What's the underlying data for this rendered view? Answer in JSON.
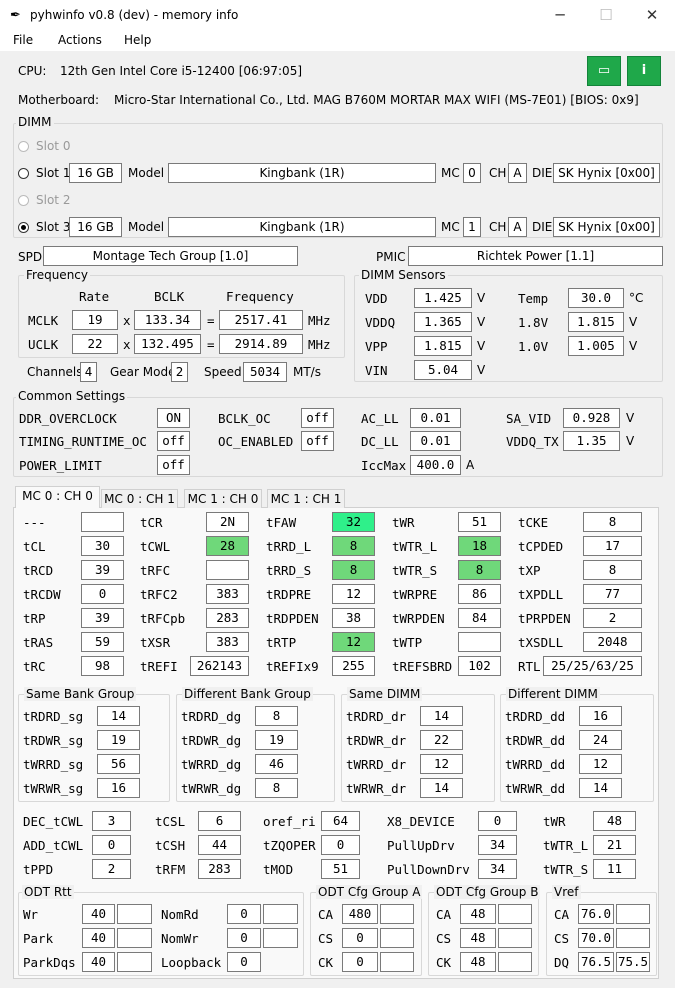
{
  "window": {
    "title": "pyhwinfo v0.8 (dev) - memory info",
    "icon": "feather-icon",
    "minimize": "─",
    "maximize": "☐",
    "close": "✕"
  },
  "menu": {
    "file": "File",
    "actions": "Actions",
    "help": "Help"
  },
  "cpu": {
    "label": "CPU:",
    "value": "12th Gen Intel Core i5-12400  [06:97:05]"
  },
  "mb": {
    "label": "Motherboard:",
    "value": "Micro-Star International Co., Ltd. MAG B760M MORTAR MAX WIFI (MS-7E01)  [BIOS: 0x9]"
  },
  "buttons": {
    "save_icon": "▭",
    "info_icon": "i",
    "accent": "#1fa84a"
  },
  "dimm": {
    "title": "DIMM",
    "model_label": "Model",
    "mc_label": "MC",
    "ch_label": "CH",
    "die_label": "DIE",
    "slots": [
      {
        "label": "Slot 0",
        "enabled": false,
        "checked": false
      },
      {
        "label": "Slot 1",
        "enabled": true,
        "checked": false,
        "size": "16 GB",
        "model": "Kingbank      (1R)",
        "mc": "0",
        "ch": "A",
        "die": "SK Hynix [0x00]"
      },
      {
        "label": "Slot 2",
        "enabled": false,
        "checked": false
      },
      {
        "label": "Slot 3",
        "enabled": true,
        "checked": true,
        "size": "16 GB",
        "model": "Kingbank      (1R)",
        "mc": "1",
        "ch": "A",
        "die": "SK Hynix [0x00]"
      }
    ]
  },
  "spd": {
    "label": "SPD",
    "value": "Montage Tech Group [1.0]"
  },
  "pmic": {
    "label": "PMIC",
    "value": "Richtek Power [1.1]"
  },
  "freq": {
    "title": "Frequency",
    "h_rate": "Rate",
    "h_bclk": "BCLK",
    "h_freq": "Frequency",
    "x": "x",
    "eq": "=",
    "mhz": "MHz",
    "mclk": {
      "label": "MCLK",
      "rate": "19",
      "bclk": "133.34",
      "freq": "2517.41"
    },
    "uclk": {
      "label": "UCLK",
      "rate": "22",
      "bclk": "132.495",
      "freq": "2914.89"
    },
    "channels_label": "Channels",
    "channels": "4",
    "gear_label": "Gear Mode",
    "gear": "2",
    "speed_label": "Speed",
    "speed": "5034",
    "speed_unit": "MT/s"
  },
  "sensors": {
    "title": "DIMM Sensors",
    "v": "V",
    "c": "°C",
    "vdd": {
      "label": "VDD",
      "value": "1.425"
    },
    "vddq": {
      "label": "VDDQ",
      "value": "1.365"
    },
    "vpp": {
      "label": "VPP",
      "value": "1.815"
    },
    "vin": {
      "label": "VIN",
      "value": "5.04"
    },
    "temp": {
      "label": "Temp",
      "value": "30.0"
    },
    "v18": {
      "label": "1.8V",
      "value": "1.815"
    },
    "v10": {
      "label": "1.0V",
      "value": "1.005"
    }
  },
  "common": {
    "title": "Common Settings",
    "v": "V",
    "a": "A",
    "ddr_oc": {
      "label": "DDR_OVERCLOCK",
      "value": "ON"
    },
    "bclk_oc": {
      "label": "BCLK_OC",
      "value": "off"
    },
    "ac_ll": {
      "label": "AC_LL",
      "value": "0.01"
    },
    "sa_vid": {
      "label": "SA_VID",
      "value": "0.928"
    },
    "timing_rt": {
      "label": "TIMING_RUNTIME_OC",
      "value": "off"
    },
    "oc_en": {
      "label": "OC_ENABLED",
      "value": "off"
    },
    "dc_ll": {
      "label": "DC_LL",
      "value": "0.01"
    },
    "vddq_tx": {
      "label": "VDDQ_TX",
      "value": "1.35"
    },
    "power_limit": {
      "label": "POWER_LIMIT",
      "value": "off"
    },
    "iccmax": {
      "label": "IccMax",
      "value": "400.0"
    }
  },
  "tabs": [
    "MC 0 : CH 0",
    "MC 0 : CH 1",
    "MC 1 : CH 0",
    "MC 1 : CH 1"
  ],
  "timings": {
    "highlight_color": "#6fd87a",
    "rows": [
      [
        {
          "l": "---",
          "v": ""
        },
        {
          "l": "tCR",
          "v": "2N"
        },
        {
          "l": "tFAW",
          "v": "32",
          "h": "bg"
        },
        {
          "l": "tWR",
          "v": "51"
        },
        {
          "l": "tCKE",
          "v": "8"
        }
      ],
      [
        {
          "l": "tCL",
          "v": "30"
        },
        {
          "l": "tCWL",
          "v": "28",
          "h": "g"
        },
        {
          "l": "tRRD_L",
          "v": "8",
          "h": "g"
        },
        {
          "l": "tWTR_L",
          "v": "18",
          "h": "g"
        },
        {
          "l": "tCPDED",
          "v": "17"
        }
      ],
      [
        {
          "l": "tRCD",
          "v": "39"
        },
        {
          "l": "tRFC",
          "v": ""
        },
        {
          "l": "tRRD_S",
          "v": "8",
          "h": "g"
        },
        {
          "l": "tWTR_S",
          "v": "8",
          "h": "g"
        },
        {
          "l": "tXP",
          "v": "8"
        }
      ],
      [
        {
          "l": "tRCDW",
          "v": "0"
        },
        {
          "l": "tRFC2",
          "v": "383"
        },
        {
          "l": "tRDPRE",
          "v": "12"
        },
        {
          "l": "tWRPRE",
          "v": "86"
        },
        {
          "l": "tXPDLL",
          "v": "77"
        }
      ],
      [
        {
          "l": "tRP",
          "v": "39"
        },
        {
          "l": "tRFCpb",
          "v": "283"
        },
        {
          "l": "tRDPDEN",
          "v": "38"
        },
        {
          "l": "tWRPDEN",
          "v": "84"
        },
        {
          "l": "tPRPDEN",
          "v": "2"
        }
      ],
      [
        {
          "l": "tRAS",
          "v": "59"
        },
        {
          "l": "tXSR",
          "v": "383"
        },
        {
          "l": "tRTP",
          "v": "12",
          "h": "g"
        },
        {
          "l": "tWTP",
          "v": ""
        },
        {
          "l": "tXSDLL",
          "v": "2048"
        }
      ],
      [
        {
          "l": "tRC",
          "v": "98"
        },
        {
          "l": "tREFI",
          "v": "262143"
        },
        {
          "l": "tREFIx9",
          "v": "255"
        },
        {
          "l": "tREFSBRD",
          "v": "102"
        },
        {
          "l": "RTL",
          "v": "25/25/63/25"
        }
      ]
    ]
  },
  "groups": [
    {
      "title": "Same Bank Group",
      "rows": [
        {
          "l": "tRDRD_sg",
          "v": "14"
        },
        {
          "l": "tRDWR_sg",
          "v": "19"
        },
        {
          "l": "tWRRD_sg",
          "v": "56"
        },
        {
          "l": "tWRWR_sg",
          "v": "16"
        }
      ]
    },
    {
      "title": "Different Bank Group",
      "rows": [
        {
          "l": "tRDRD_dg",
          "v": "8"
        },
        {
          "l": "tRDWR_dg",
          "v": "19"
        },
        {
          "l": "tWRRD_dg",
          "v": "46"
        },
        {
          "l": "tWRWR_dg",
          "v": "8"
        }
      ]
    },
    {
      "title": "Same DIMM",
      "rows": [
        {
          "l": "tRDRD_dr",
          "v": "14"
        },
        {
          "l": "tRDWR_dr",
          "v": "22"
        },
        {
          "l": "tWRRD_dr",
          "v": "12"
        },
        {
          "l": "tWRWR_dr",
          "v": "14"
        }
      ]
    },
    {
      "title": "Different DIMM",
      "rows": [
        {
          "l": "tRDRD_dd",
          "v": "16"
        },
        {
          "l": "tRDWR_dd",
          "v": "24"
        },
        {
          "l": "tWRRD_dd",
          "v": "12"
        },
        {
          "l": "tWRWR_dd",
          "v": "14"
        }
      ]
    }
  ],
  "misc": [
    [
      {
        "l": "DEC_tCWL",
        "v": "3"
      },
      {
        "l": "tCSL",
        "v": "6"
      },
      {
        "l": "oref_ri",
        "v": "64"
      },
      {
        "l": "X8_DEVICE",
        "v": "0"
      },
      {
        "l": "tWR",
        "v": "48"
      }
    ],
    [
      {
        "l": "ADD_tCWL",
        "v": "0"
      },
      {
        "l": "tCSH",
        "v": "44"
      },
      {
        "l": "tZQOPER",
        "v": "0"
      },
      {
        "l": "PullUpDrv",
        "v": "34"
      },
      {
        "l": "tWTR_L",
        "v": "21"
      }
    ],
    [
      {
        "l": "tPPD",
        "v": "2"
      },
      {
        "l": "tRFM",
        "v": "283"
      },
      {
        "l": "tMOD",
        "v": "51"
      },
      {
        "l": "PullDownDrv",
        "v": "34"
      },
      {
        "l": "tWTR_S",
        "v": "11"
      }
    ]
  ],
  "odt_rtt": {
    "title": "ODT Rtt",
    "rows": [
      {
        "l1": "Wr",
        "v1": "40",
        "v1b": "",
        "l2": "NomRd",
        "v2": "0",
        "v2b": ""
      },
      {
        "l1": "Park",
        "v1": "40",
        "v1b": "",
        "l2": "NomWr",
        "v2": "0",
        "v2b": ""
      },
      {
        "l1": "ParkDqs",
        "v1": "40",
        "v1b": "",
        "l2": "Loopback",
        "v2": "0",
        "v2b": null
      }
    ]
  },
  "odt_a": {
    "title": "ODT Cfg Group A",
    "rows": [
      {
        "l": "CA",
        "v": "480",
        "b": ""
      },
      {
        "l": "CS",
        "v": "0",
        "b": ""
      },
      {
        "l": "CK",
        "v": "0",
        "b": ""
      }
    ]
  },
  "odt_b": {
    "title": "ODT Cfg Group B",
    "rows": [
      {
        "l": "CA",
        "v": "48",
        "b": ""
      },
      {
        "l": "CS",
        "v": "48",
        "b": ""
      },
      {
        "l": "CK",
        "v": "48",
        "b": ""
      }
    ]
  },
  "vref": {
    "title": "Vref",
    "rows": [
      {
        "l": "CA",
        "v": "76.0",
        "b": ""
      },
      {
        "l": "CS",
        "v": "70.0",
        "b": ""
      },
      {
        "l": "DQ",
        "v": "76.5",
        "b": "75.5"
      }
    ]
  }
}
